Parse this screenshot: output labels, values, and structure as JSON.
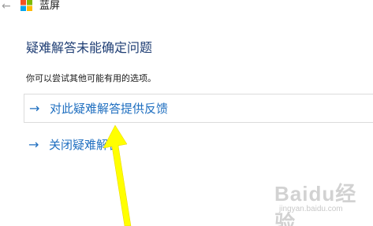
{
  "window": {
    "back_icon": "back-arrow-icon",
    "app_icon": "windows-logo-icon",
    "app_title": "蓝屏"
  },
  "main": {
    "title": "疑难解答未能确定问题",
    "subtitle": "你可以尝试其他可能有用的选项。",
    "options": [
      {
        "icon": "arrow-right-icon",
        "label": "对此疑难解答提供反馈"
      },
      {
        "icon": "arrow-right-icon",
        "label": "关闭疑难解答"
      }
    ]
  },
  "watermark": {
    "logo": "Baidu经验",
    "site": "jingyan.baidu.com"
  },
  "colors": {
    "title": "#1f3e74",
    "link": "#1f6fc0",
    "annotation_arrow": "#ffff00",
    "logo_red": "#f25022",
    "logo_green": "#7fba00",
    "logo_blue": "#00a4ef",
    "logo_yellow": "#ffb900"
  }
}
